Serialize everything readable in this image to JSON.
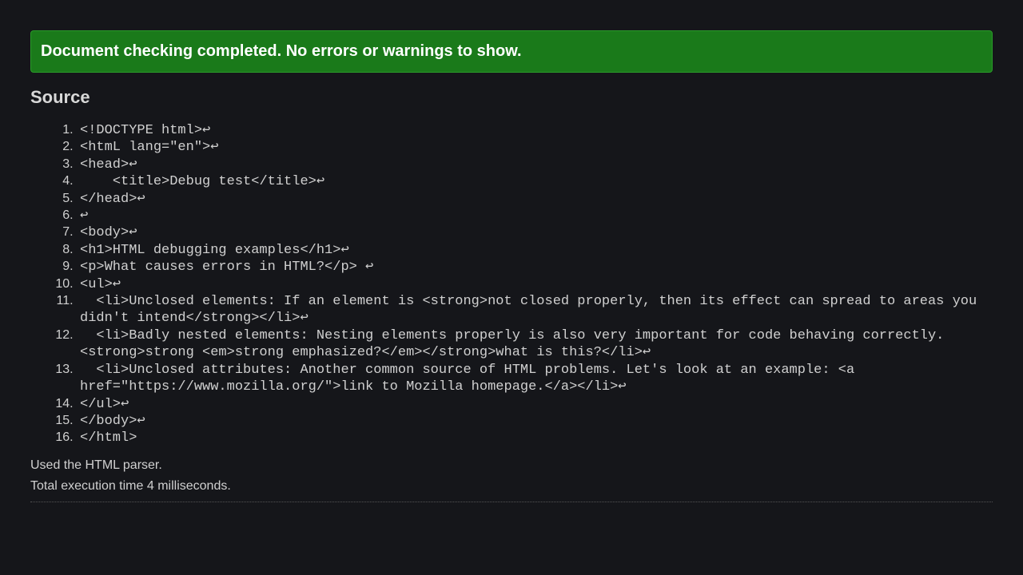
{
  "banner": {
    "message": "Document checking completed. No errors or warnings to show."
  },
  "source": {
    "heading": "Source",
    "lines": [
      "<!DOCTYPE html>↩",
      "<htmL lang=\"en\">↩",
      "<head>↩",
      "    <title>Debug test</title>↩",
      "</head>↩",
      "↩",
      "<body>↩",
      "<h1>HTML debugging examples</h1>↩",
      "<p>What causes errors in HTML?</p> ↩",
      "<ul>↩",
      "  <li>Unclosed elements: If an element is <strong>not closed properly, then its effect can spread to areas you didn't intend</strong></li>↩",
      "  <li>Badly nested elements: Nesting elements properly is also very important for code behaving correctly. <strong>strong <em>strong emphasized?</em></strong>what is this?</li>↩",
      "  <li>Unclosed attributes: Another common source of HTML problems. Let's look at an example: <a href=\"https://www.mozilla.org/\">link to Mozilla homepage.</a></li>↩",
      "</ul>↩",
      "</body>↩",
      "</html>"
    ]
  },
  "footer": {
    "parser": "Used the HTML parser.",
    "timing": "Total execution time 4 milliseconds."
  }
}
